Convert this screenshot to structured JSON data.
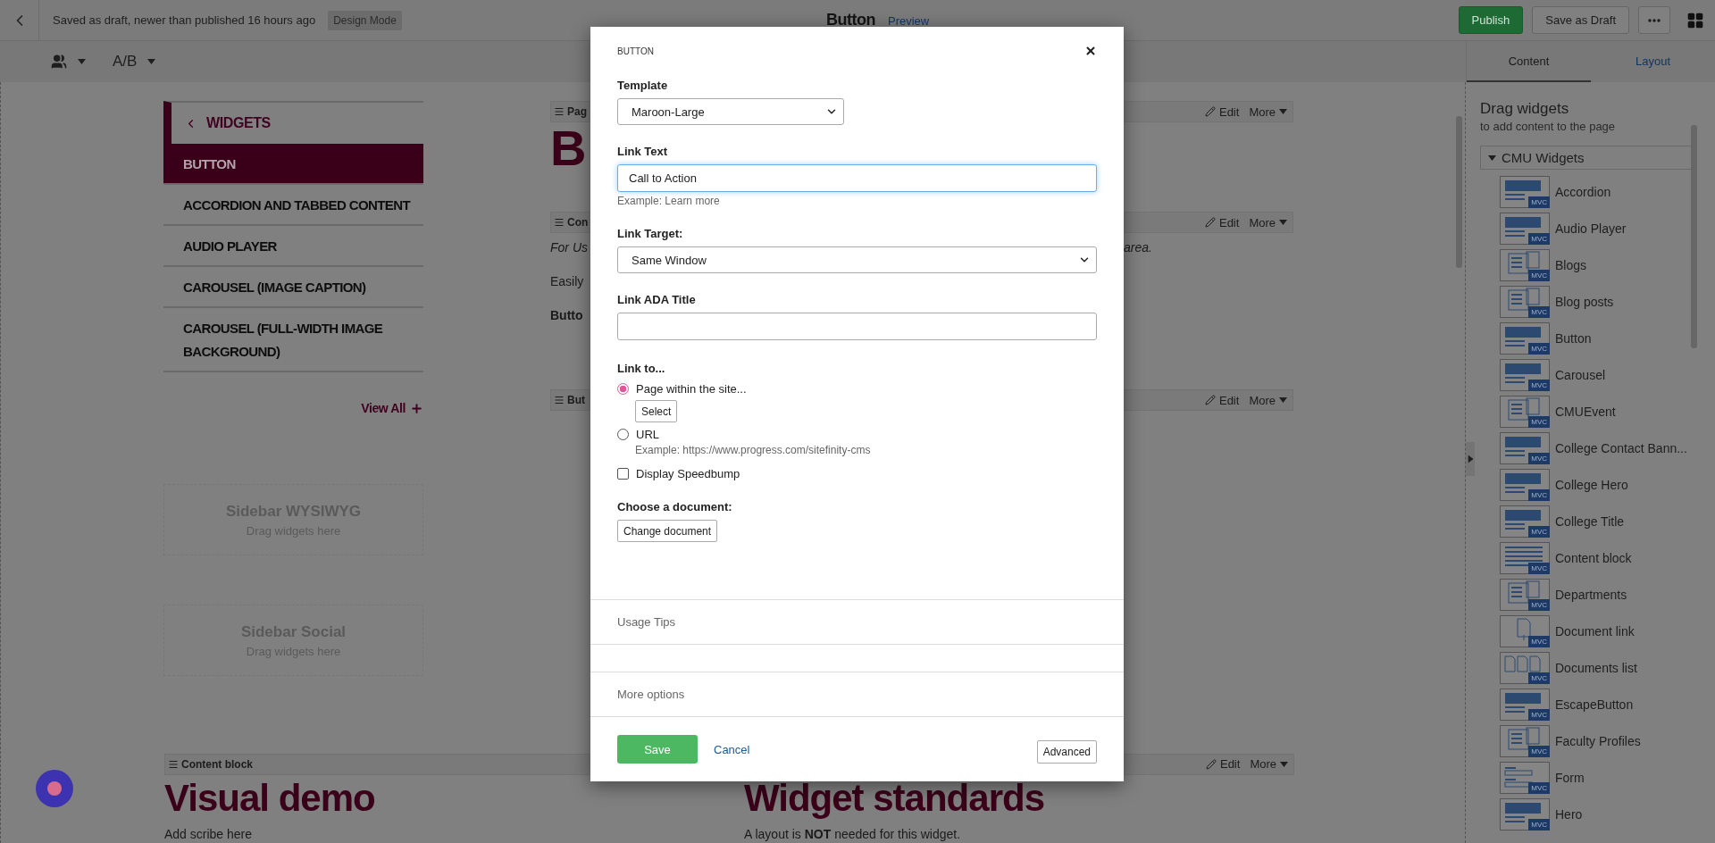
{
  "top_bar": {
    "status": "Saved as draft, newer than published 16 hours ago",
    "mode_badge": "Design Mode",
    "title": "Button",
    "preview_link": "Preview",
    "buttons": [
      {
        "label": "Publish",
        "kind": "primary"
      },
      {
        "label": "Save as Draft",
        "kind": "default"
      }
    ]
  },
  "toolbar": {
    "ab_label": "A/B"
  },
  "panel_tabs": [
    {
      "label": "Content",
      "selected": true
    },
    {
      "label": "Layout",
      "selected": false
    }
  ],
  "nav": {
    "header": "WIDGETS",
    "items": [
      {
        "label": "BUTTON",
        "selected": true
      },
      {
        "label": "ACCORDION AND TABBED CONTENT",
        "selected": false
      },
      {
        "label": "AUDIO PLAYER",
        "selected": false
      },
      {
        "label": "CAROUSEL (IMAGE CAPTION)",
        "selected": false
      },
      {
        "label": "CAROUSEL (FULL-WIDTH IMAGE BACKGROUND)",
        "selected": false
      }
    ],
    "view_all": "View All"
  },
  "placeholders": [
    {
      "title": "Sidebar WYSIWYG",
      "hint": "Drag widgets here"
    },
    {
      "title": "Sidebar Social",
      "hint": "Drag widgets here"
    }
  ],
  "main_blocks": [
    {
      "kind": "heading",
      "bar": "Pag",
      "edit": "Edit",
      "more": "More",
      "heading": "B"
    },
    {
      "kind": "text",
      "bar": "Con",
      "edit": "Edit",
      "more": "More",
      "italic_start": "For Us",
      "italic_end": "area.",
      "line": "Easily",
      "bold_line": "Butto"
    },
    {
      "kind": "empty",
      "bar": "But",
      "edit": "Edit",
      "more": "More"
    }
  ],
  "bottom_blocks": [
    {
      "bar": "Content block",
      "heading": "Visual demo",
      "text": "Add scribe here"
    },
    {
      "edit": "Edit",
      "more": "More",
      "heading": "Widget standards",
      "text": "A layout is **NOT** needed for this widget."
    }
  ],
  "widget_panel": {
    "title": "Drag widgets",
    "subtitle": "to add content to the page",
    "group": {
      "label": "CMU Widgets",
      "expanded": true,
      "items": [
        {
          "label": "Accordion",
          "kind": "banner",
          "badge": "MVC"
        },
        {
          "label": "Audio Player",
          "kind": "banner",
          "badge": "MVC"
        },
        {
          "label": "Blogs",
          "kind": "list",
          "badge": "MVC"
        },
        {
          "label": "Blog posts",
          "kind": "list",
          "badge": "MVC"
        },
        {
          "label": "Button",
          "kind": "banner",
          "badge": "MVC"
        },
        {
          "label": "Carousel",
          "kind": "banner",
          "badge": "MVC"
        },
        {
          "label": "CMUEvent",
          "kind": "list",
          "badge": "MVC"
        },
        {
          "label": "College Contact Bann...",
          "kind": "banner",
          "badge": "MVC"
        },
        {
          "label": "College Hero",
          "kind": "banner",
          "badge": "MVC"
        },
        {
          "label": "College Title",
          "kind": "banner",
          "badge": "MVC"
        },
        {
          "label": "Content block",
          "kind": "text",
          "badge": "MVC"
        },
        {
          "label": "Departments",
          "kind": "list",
          "badge": "MVC"
        },
        {
          "label": "Document link",
          "kind": "document",
          "badge": "MVC"
        },
        {
          "label": "Documents list",
          "kind": "documents",
          "badge": "MVC"
        },
        {
          "label": "EscapeButton",
          "kind": "banner",
          "badge": "MVC"
        },
        {
          "label": "Faculty Profiles",
          "kind": "list",
          "badge": "MVC"
        },
        {
          "label": "Form",
          "kind": "form",
          "badge": "MVC"
        },
        {
          "label": "Hero",
          "kind": "banner",
          "badge": "MVC"
        }
      ]
    }
  },
  "dialog": {
    "title": "BUTTON",
    "template": {
      "label": "Template",
      "value": "Maroon-Large"
    },
    "link_text": {
      "label": "Link Text",
      "value": "Call to Action",
      "focused": true,
      "hint": "Example: Learn more"
    },
    "link_target": {
      "label": "Link Target:",
      "value": "Same Window"
    },
    "link_ada_title": {
      "label": "Link ADA Title"
    },
    "link_to": {
      "label": "Link to...",
      "options": [
        {
          "label": "Page within the site...",
          "selected": true,
          "button": "Select"
        },
        {
          "label": "URL",
          "selected": false,
          "hint": "Example: https://www.progress.com/sitefinity-cms"
        }
      ]
    },
    "speedbump": {
      "label": "Display Speedbump",
      "checked": false
    },
    "document": {
      "label": "Choose a document:",
      "button": "Change document"
    },
    "sections": [
      {
        "label": "Usage Tips"
      },
      {
        "label": "More options"
      }
    ],
    "footer": {
      "save": "Save",
      "cancel": "Cancel",
      "advanced": "Advanced"
    }
  }
}
